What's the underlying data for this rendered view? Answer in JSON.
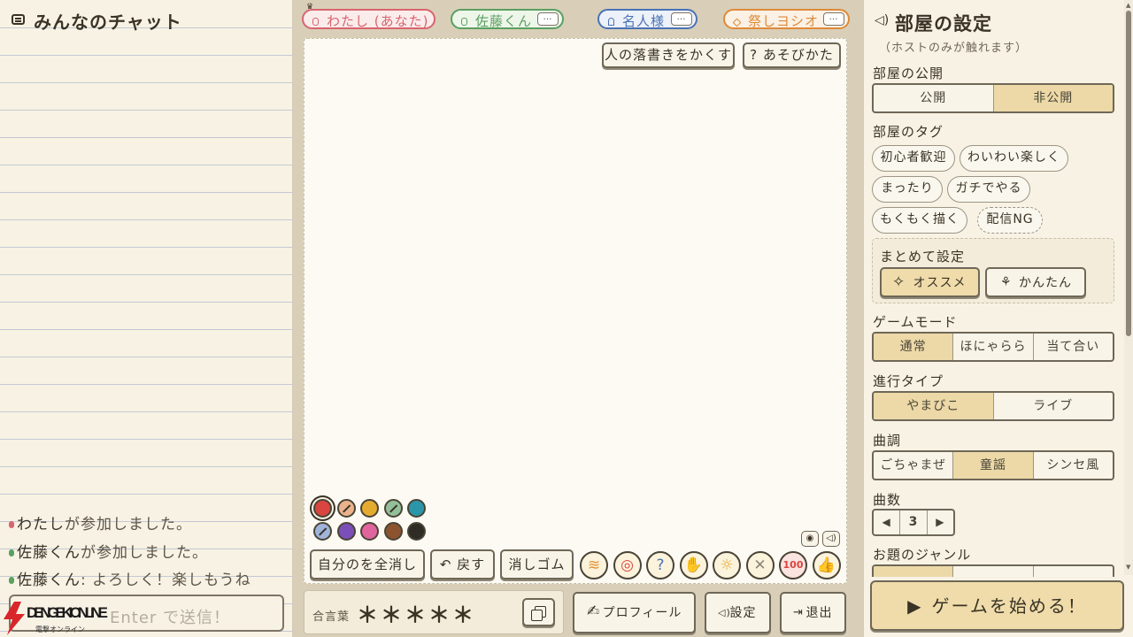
{
  "chat": {
    "title": "みんなのチャット",
    "messages": [
      {
        "name": "わたし",
        "text": "が参加しました。",
        "color": "#d9646e"
      },
      {
        "name": "佐藤くん",
        "text": "が参加しました。",
        "color": "#5aa061"
      },
      {
        "name": "佐藤くん",
        "text": ": よろしく！楽しもうね",
        "color": "#5aa061"
      }
    ],
    "input_placeholder": "Enter で送信！"
  },
  "logo": {
    "text": "DENGEKI ONLINE",
    "sub": "電撃オンライン"
  },
  "players": [
    {
      "name": "わたし (あなた)",
      "color": "#d9646e",
      "host": true
    },
    {
      "name": "佐藤くん",
      "color": "#5aa061",
      "more": "…"
    },
    {
      "name": "名人様",
      "color": "#4a72b5",
      "more": "…"
    },
    {
      "name": "祭しヨシオ",
      "color": "#de8a3a",
      "more": "…"
    }
  ],
  "canvas_tools": {
    "hide_others_label": "人の落書きをかくす",
    "howto_label": "? あそびかた",
    "clear_mine_label": "自分のを全消し",
    "undo_label": "↶ 戻す",
    "eraser_label": "消しゴム",
    "palette": [
      "#d9463f",
      "#eab38c",
      "#e4ab2e",
      "#93c09a",
      "#2a96a8",
      "#9fb4d9",
      "#7a4fb8",
      "#e0659e",
      "#8b542e",
      "#2f2b25"
    ],
    "emoji_names": [
      "laugh-icon",
      "face-icon",
      "question-icon",
      "hand-icon",
      "bulb-icon",
      "dizzy-icon",
      "hundred-icon",
      "thumbs-up-icon"
    ],
    "emoji_colors": [
      "#e3943a",
      "#d9463f",
      "#4a72b5",
      "#d4567e",
      "#e4ab2e",
      "#8d8678",
      "#d9463f",
      "#5aa061"
    ]
  },
  "password": {
    "label": "合言葉",
    "value": "＊＊＊＊＊"
  },
  "bottom": {
    "profile_label": "プロフィール",
    "settings_label": "設定",
    "exit_label": "退出"
  },
  "room": {
    "title": "部屋の設定",
    "subtitle": "（ホストのみが触れます）",
    "visibility": {
      "label": "部屋の公開",
      "options": [
        "公開",
        "非公開"
      ],
      "selected": 1
    },
    "tags": {
      "label": "部屋のタグ",
      "items": [
        "初心者歓迎",
        "わいわい楽しく",
        "まったり",
        "ガチでやる",
        "もくもく描く",
        "配信NG"
      ]
    },
    "preset": {
      "label": "まとめて設定",
      "recommended": "オススメ",
      "easy": "かんたん"
    },
    "game_mode": {
      "label": "ゲームモード",
      "options": [
        "通常",
        "ほにゃらら",
        "当て合い"
      ],
      "selected": 0
    },
    "progress": {
      "label": "進行タイプ",
      "options": [
        "やまびこ",
        "ライブ"
      ],
      "selected": 0
    },
    "tune": {
      "label": "曲調",
      "options": [
        "ごちゃまぜ",
        "童謡",
        "シンセ風"
      ],
      "selected": 1
    },
    "songs": {
      "label": "曲数",
      "value": "3"
    },
    "genre": {
      "label": "お題のジャンル"
    },
    "start_label": "ゲームを始める！"
  }
}
